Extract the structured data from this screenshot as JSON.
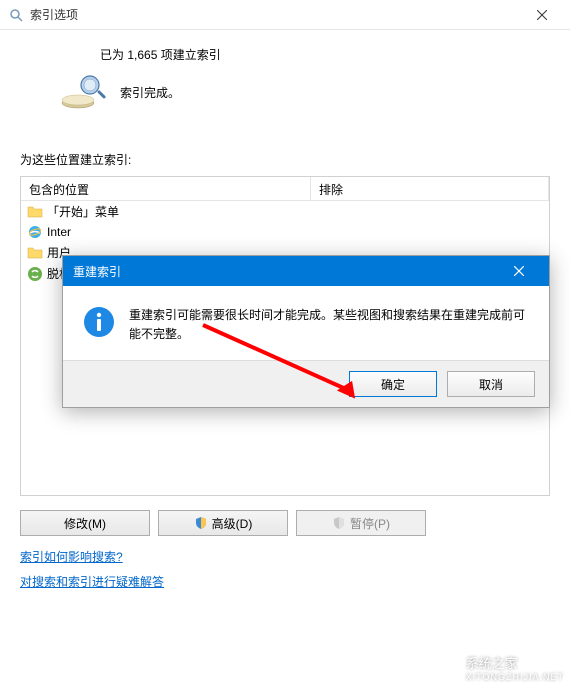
{
  "titlebar": {
    "title": "索引选项"
  },
  "status": {
    "indexed_text": "已为 1,665 项建立索引",
    "complete_text": "索引完成。"
  },
  "locations": {
    "section_label": "为这些位置建立索引:",
    "col1_header": "包含的位置",
    "col2_header": "排除",
    "items": [
      {
        "label": "「开始」菜单",
        "icon": "folder"
      },
      {
        "label": "Inter",
        "icon": "ie"
      },
      {
        "label": "用户",
        "icon": "folder"
      },
      {
        "label": "脱机",
        "icon": "sync"
      }
    ]
  },
  "buttons": {
    "modify": "修改(M)",
    "advanced": "高级(D)",
    "pause": "暂停(P)"
  },
  "links": {
    "how_affects": "索引如何影响搜索?",
    "troubleshoot": "对搜索和索引进行疑难解答"
  },
  "modal": {
    "title": "重建索引",
    "message": "重建索引可能需要很长时间才能完成。某些视图和搜索结果在重建完成前可能不完整。",
    "ok": "确定",
    "cancel": "取消"
  },
  "watermark": {
    "name": "系统之家",
    "url": "XITONGZHIJIA.NET"
  }
}
